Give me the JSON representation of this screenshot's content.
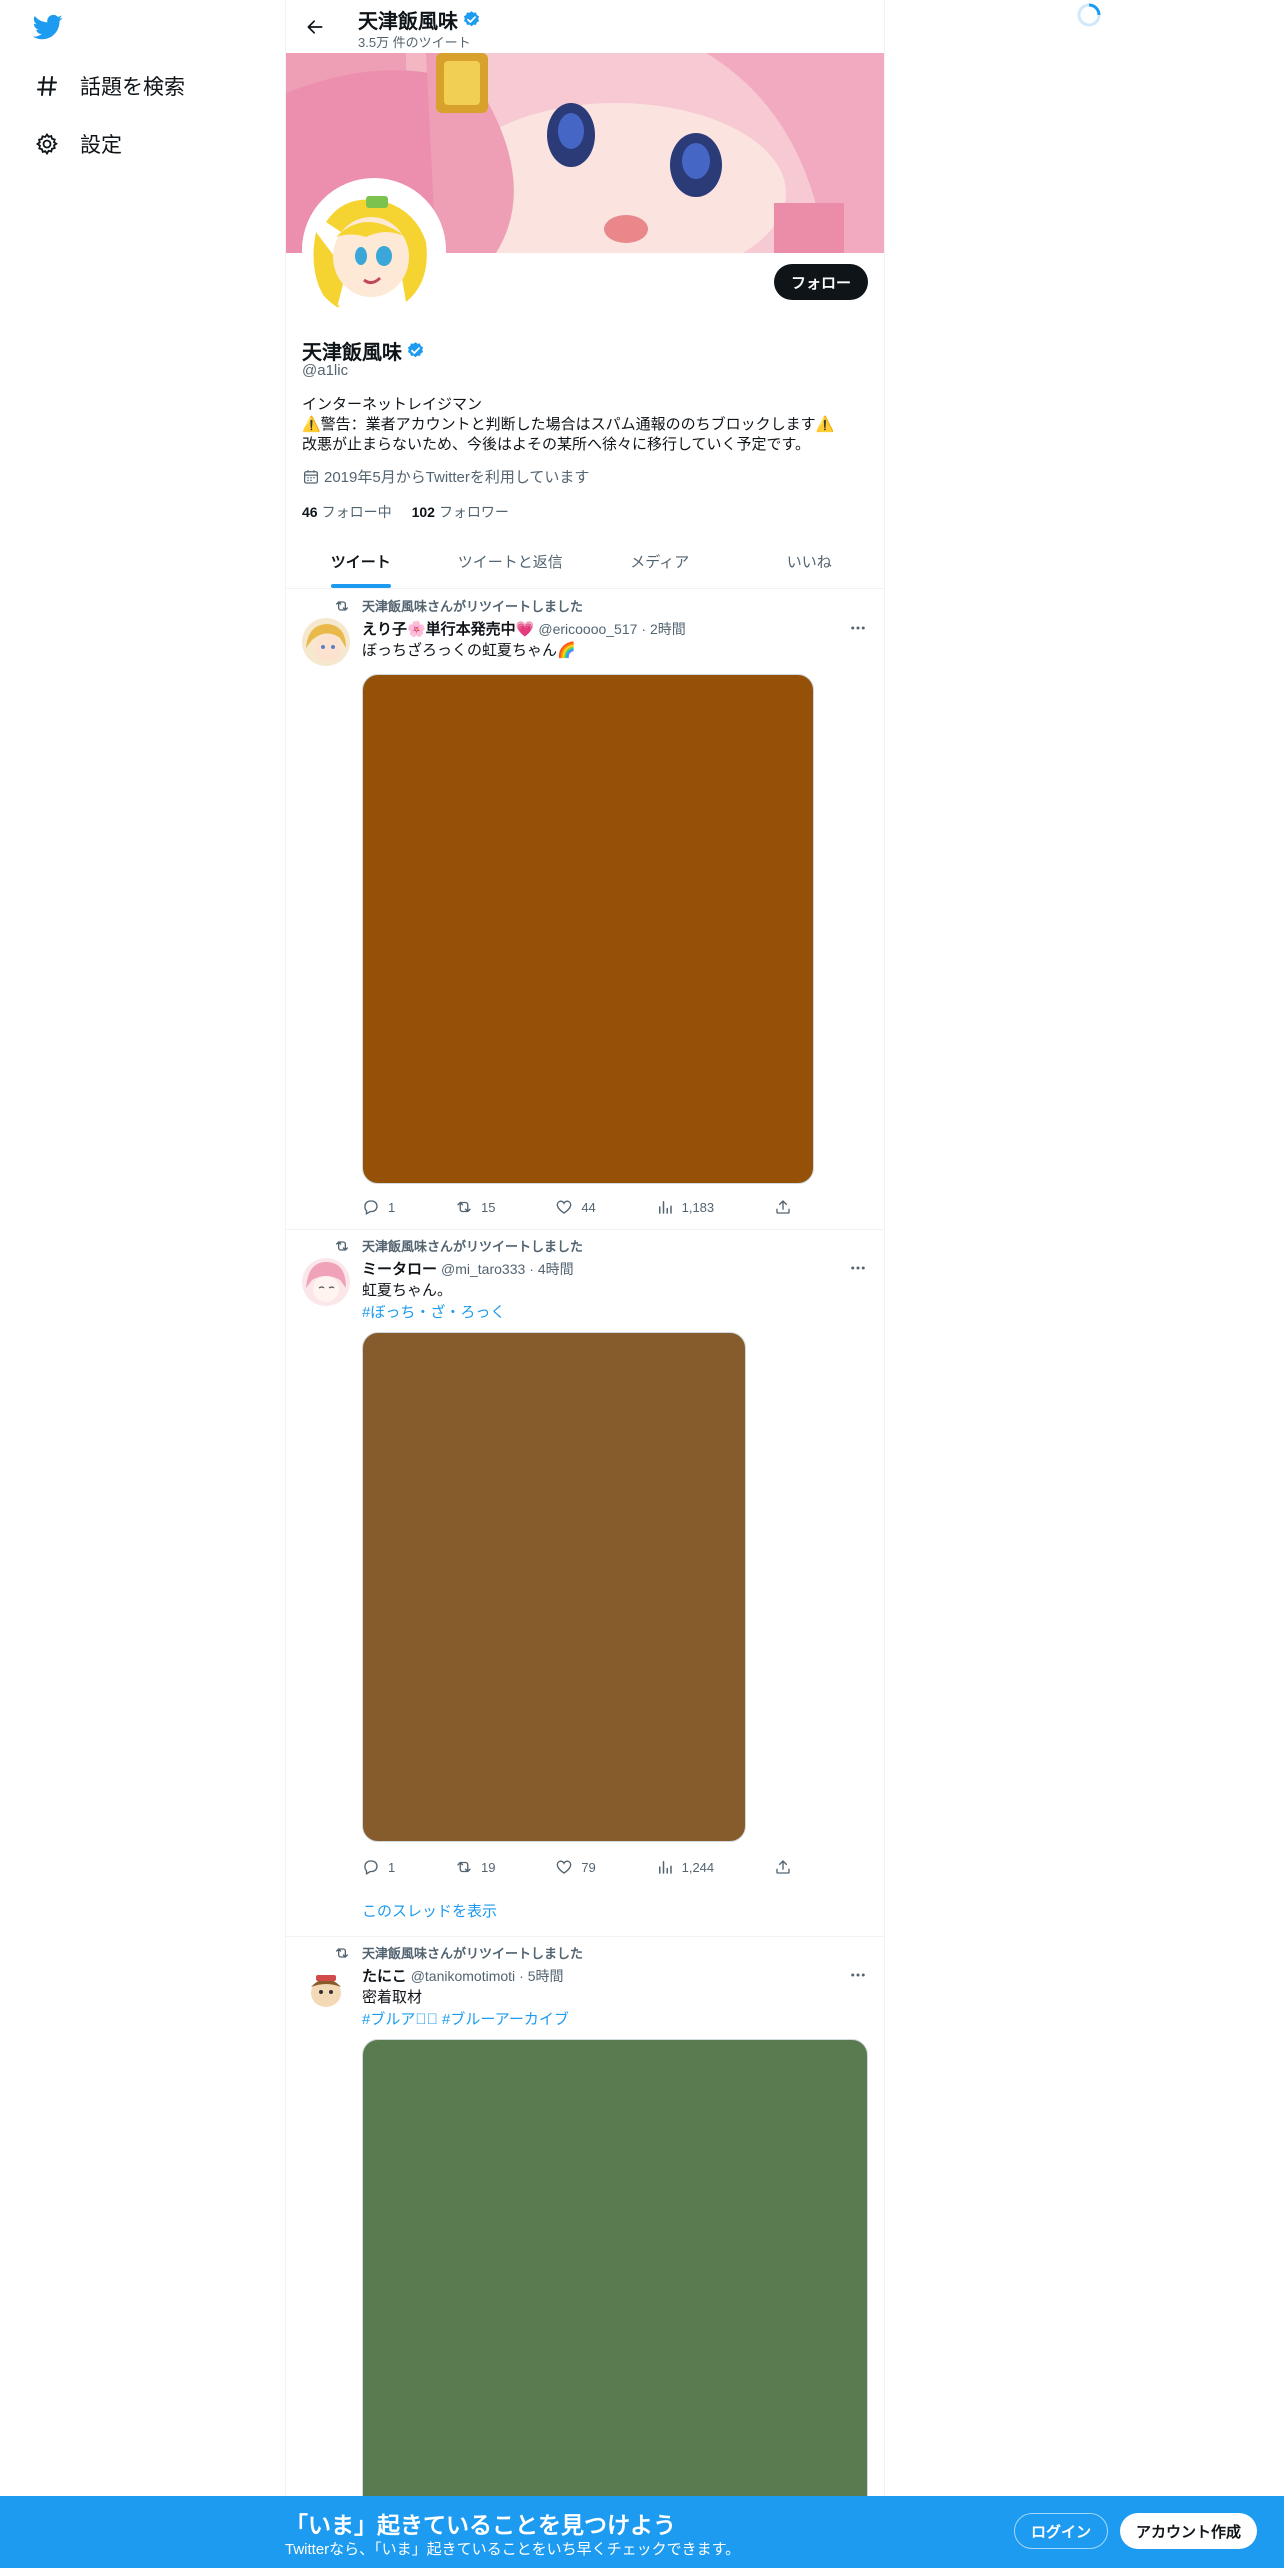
{
  "sidebar": {
    "logo_icon": "twitter-bird-icon",
    "items": [
      {
        "label": "話題を検索",
        "icon": "hashtag-icon"
      },
      {
        "label": "設定",
        "icon": "gear-icon"
      }
    ]
  },
  "header": {
    "name": "天津飯風味",
    "tweet_count": "3.5万 件のツイート"
  },
  "profile": {
    "name": "天津飯風味",
    "handle": "@a1lic",
    "follow_label": "フォロー",
    "bio": [
      "インターネットレイジマン",
      "⚠️警告：業者アカウントと判断した場合はスパム通報ののちブロックします⚠️",
      "改悪が止まらないため、今後はよその某所へ徐々に移行していく予定です。"
    ],
    "joined": "2019年5月からTwitterを利用しています",
    "following_count": "46",
    "following_label": "フォロー中",
    "followers_count": "102",
    "followers_label": "フォロワー"
  },
  "tabs": [
    {
      "label": "ツイート",
      "active": true
    },
    {
      "label": "ツイートと返信",
      "active": false
    },
    {
      "label": "メディア",
      "active": false
    },
    {
      "label": "いいね",
      "active": false
    }
  ],
  "tweets": [
    {
      "retweeted_by": "天津飯風味さんがリツイートしました",
      "name": "えり子🌸単行本発売中💗",
      "handle": "@ericoooo_517",
      "time": "· 2時間",
      "text": "ぼっちざろっくの虹夏ちゃん🌈",
      "tags": "",
      "media_color": "#955108",
      "replies": "1",
      "retweets": "15",
      "likes": "44",
      "views": "1,183"
    },
    {
      "retweeted_by": "天津飯風味さんがリツイートしました",
      "name": "ミータロー",
      "handle": "@mi_taro333",
      "time": "· 4時間",
      "text": "虹夏ちゃん。",
      "tags": "#ぼっち・ざ・ろっく",
      "media_color": "#875c2d",
      "replies": "1",
      "retweets": "19",
      "likes": "79",
      "views": "1,244",
      "thread_label": "このスレッドを表示"
    },
    {
      "retweeted_by": "天津飯風味さんがリツイートしました",
      "name": "たにこ",
      "handle": "@tanikomotimoti",
      "time": "· 5時間",
      "text": "密着取材",
      "tags": "#ブルアカ🏻 #ブルーアーカイブ",
      "media_color": "#5a7a50"
    }
  ],
  "bottom_bar": {
    "title": "「いま」起きていることを見つけよう",
    "subtitle": "Twitterなら、「いま」起きていることをいち早くチェックできます。",
    "login_label": "ログイン",
    "signup_label": "アカウント作成"
  },
  "colors": {
    "accent": "#1d9bf0",
    "text": "#0f1419",
    "muted": "#536471"
  }
}
